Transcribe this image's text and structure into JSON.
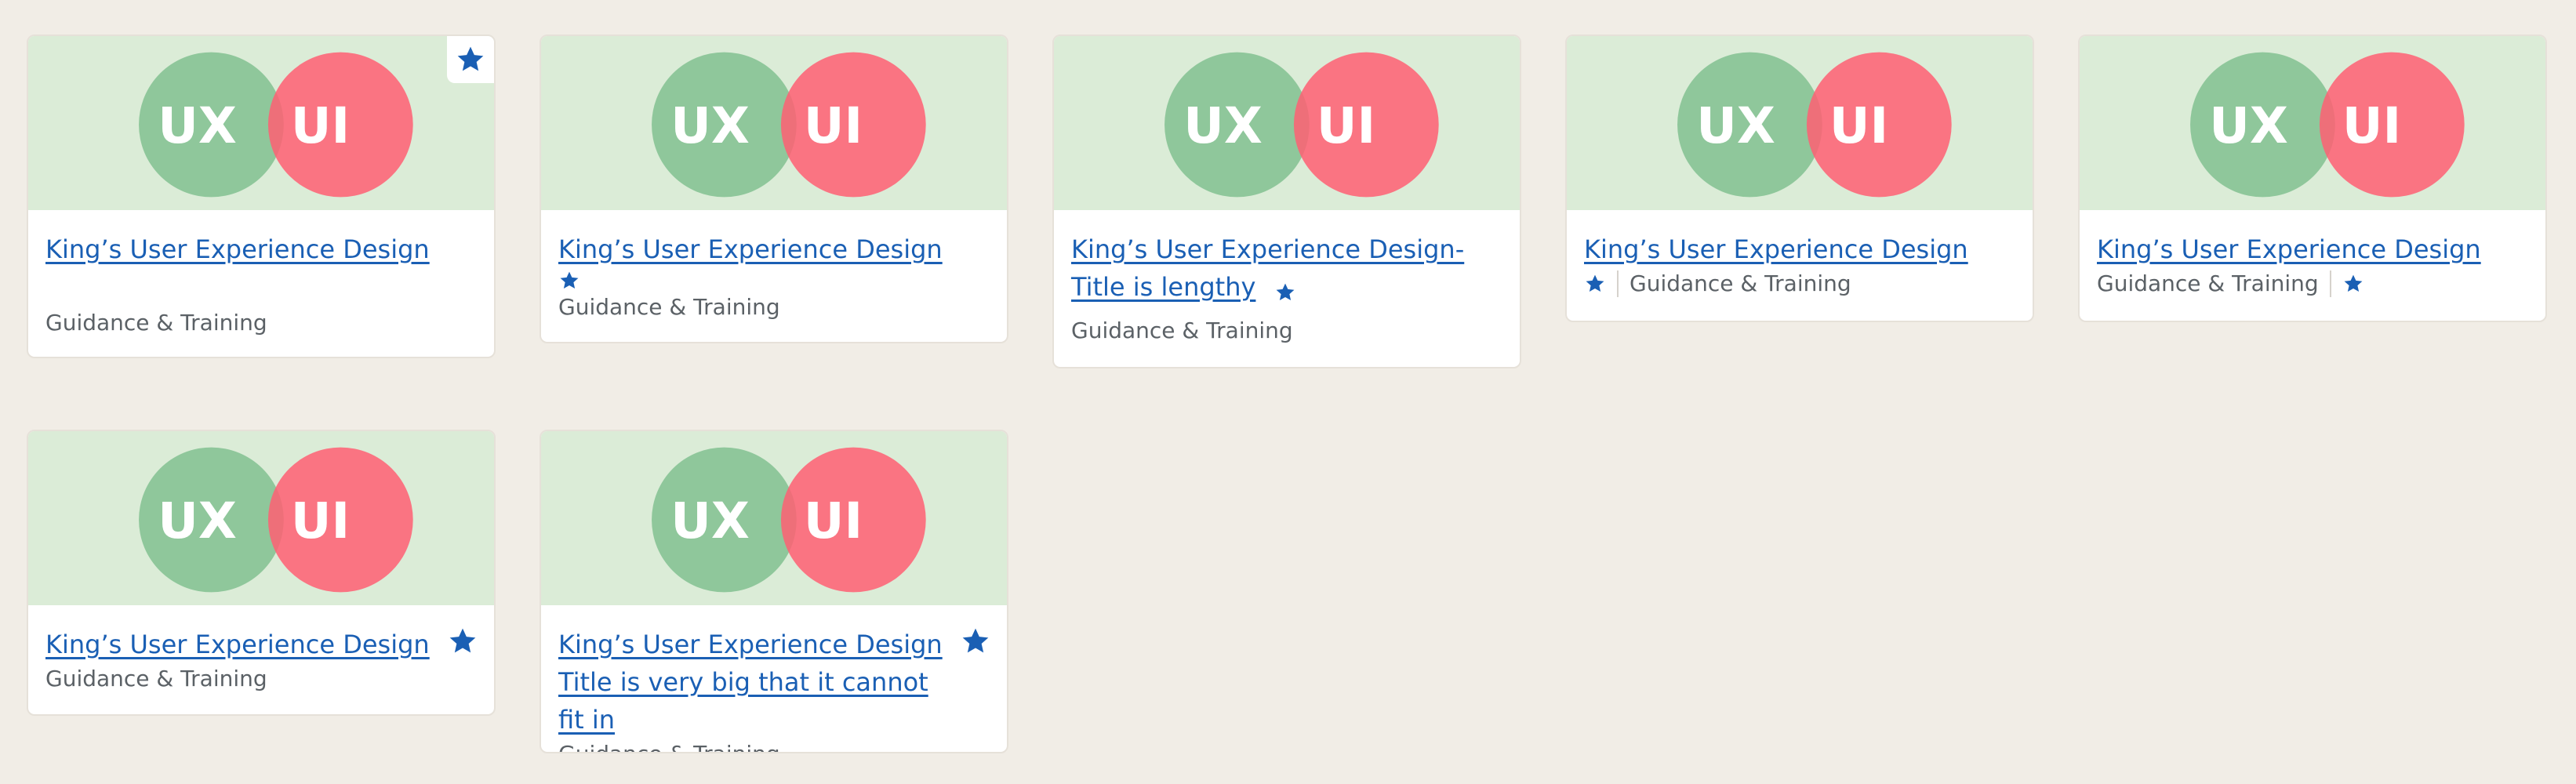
{
  "accent_color": "#1a5fb4",
  "star_icon": "star-icon",
  "cards": [
    {
      "title": "King’s User Experience Design",
      "category": "Guidance & Training",
      "star_position": "corner",
      "left_label": "UX",
      "right_label": "UI"
    },
    {
      "title": "King’s User Experience Design",
      "category": "Guidance & Training",
      "star_position": "below-title",
      "left_label": "UX",
      "right_label": "UI"
    },
    {
      "title": "King’s User Experience Design- Title is lengthy",
      "category": "Guidance & Training",
      "star_position": "inline-after-title",
      "left_label": "UX",
      "right_label": "UI"
    },
    {
      "title": "King’s User Experience Design",
      "category": "Guidance & Training",
      "star_position": "before-category",
      "left_label": "UX",
      "right_label": "UI"
    },
    {
      "title": "King’s User Experience Design",
      "category": "Guidance & Training",
      "star_position": "after-category",
      "left_label": "UX",
      "right_label": "UI"
    },
    {
      "title": "King’s User Experience Design",
      "category": "Guidance & Training",
      "star_position": "right",
      "left_label": "UX",
      "right_label": "UI"
    },
    {
      "title": "King’s User Experience Design Title is very big that it cannot fit in",
      "category": "Guidance & Training",
      "star_position": "right",
      "left_label": "UX",
      "right_label": "UI"
    }
  ]
}
